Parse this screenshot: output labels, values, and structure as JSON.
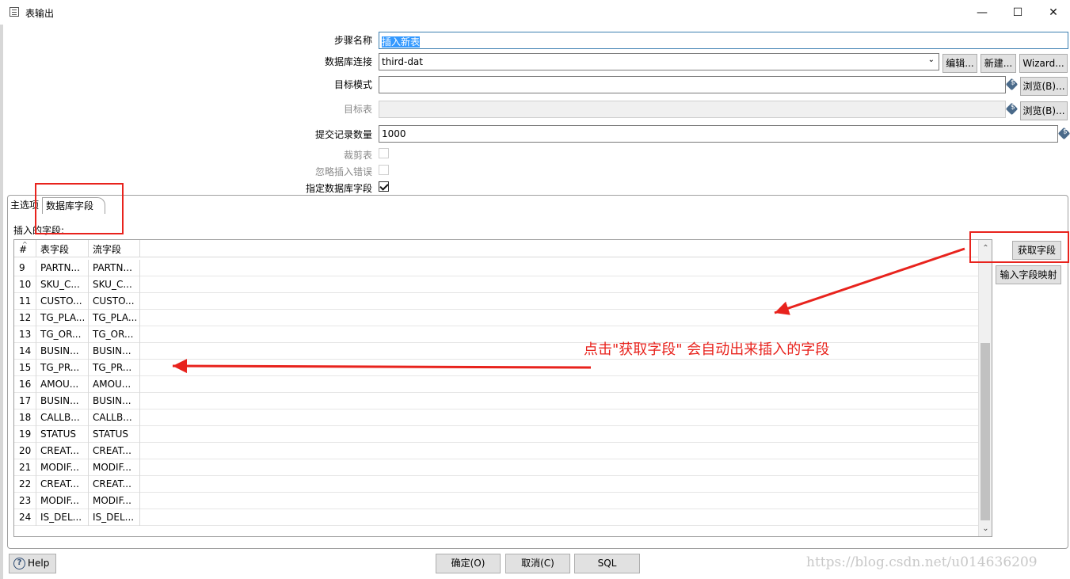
{
  "window": {
    "title": "表输出",
    "minimize": "—",
    "maximize": "☐",
    "close": "✕"
  },
  "form": {
    "step_name_label": "步骤名称",
    "step_name_value": "插入新表",
    "db_connection_label": "数据库连接",
    "db_connection_value": "third-dat",
    "edit_button": "编辑...",
    "new_button": "新建...",
    "wizard_button": "Wizard...",
    "target_schema_label": "目标模式",
    "target_schema_value": "",
    "browse_schema_button": "浏览(B)...",
    "target_table_label": "目标表",
    "target_table_value": "",
    "browse_table_button": "浏览(B)...",
    "commit_size_label": "提交记录数量",
    "commit_size_value": "1000",
    "truncate_label": "裁剪表",
    "truncate_checked": false,
    "ignore_errors_label": "忽略插入错误",
    "ignore_errors_checked": false,
    "specify_fields_label": "指定数据库字段",
    "specify_fields_checked": true
  },
  "tabs": [
    {
      "label": "主选项"
    },
    {
      "label": "数据库字段",
      "active": true
    }
  ],
  "fields_section": {
    "label": "插入的字段:",
    "columns": [
      "#",
      "表字段",
      "流字段"
    ],
    "rows": [
      [
        "9",
        "PARTN...",
        "PARTN..."
      ],
      [
        "10",
        "SKU_C...",
        "SKU_C..."
      ],
      [
        "11",
        "CUSTO...",
        "CUSTO..."
      ],
      [
        "12",
        "TG_PLA...",
        "TG_PLA..."
      ],
      [
        "13",
        "TG_OR...",
        "TG_OR..."
      ],
      [
        "14",
        "BUSIN...",
        "BUSIN..."
      ],
      [
        "15",
        "TG_PR...",
        "TG_PR..."
      ],
      [
        "16",
        "AMOU...",
        "AMOU..."
      ],
      [
        "17",
        "BUSIN...",
        "BUSIN..."
      ],
      [
        "18",
        "CALLB...",
        "CALLB..."
      ],
      [
        "19",
        "STATUS",
        "STATUS"
      ],
      [
        "20",
        "CREAT...",
        "CREAT..."
      ],
      [
        "21",
        "MODIF...",
        "MODIF..."
      ],
      [
        "22",
        "CREAT...",
        "CREAT..."
      ],
      [
        "23",
        "MODIF...",
        "MODIF..."
      ],
      [
        "24",
        "IS_DEL...",
        "IS_DEL..."
      ]
    ],
    "get_fields_button": "获取字段",
    "map_fields_button": "输入字段映射"
  },
  "annotation": {
    "text": "点击\"获取字段\" 会自动出来插入的字段",
    "color": "#e8231d"
  },
  "footer": {
    "help_button": "Help",
    "ok_button": "确定(O)",
    "cancel_button": "取消(C)",
    "sql_button": "SQL",
    "watermark": "https://blog.csdn.net/u014636209"
  }
}
